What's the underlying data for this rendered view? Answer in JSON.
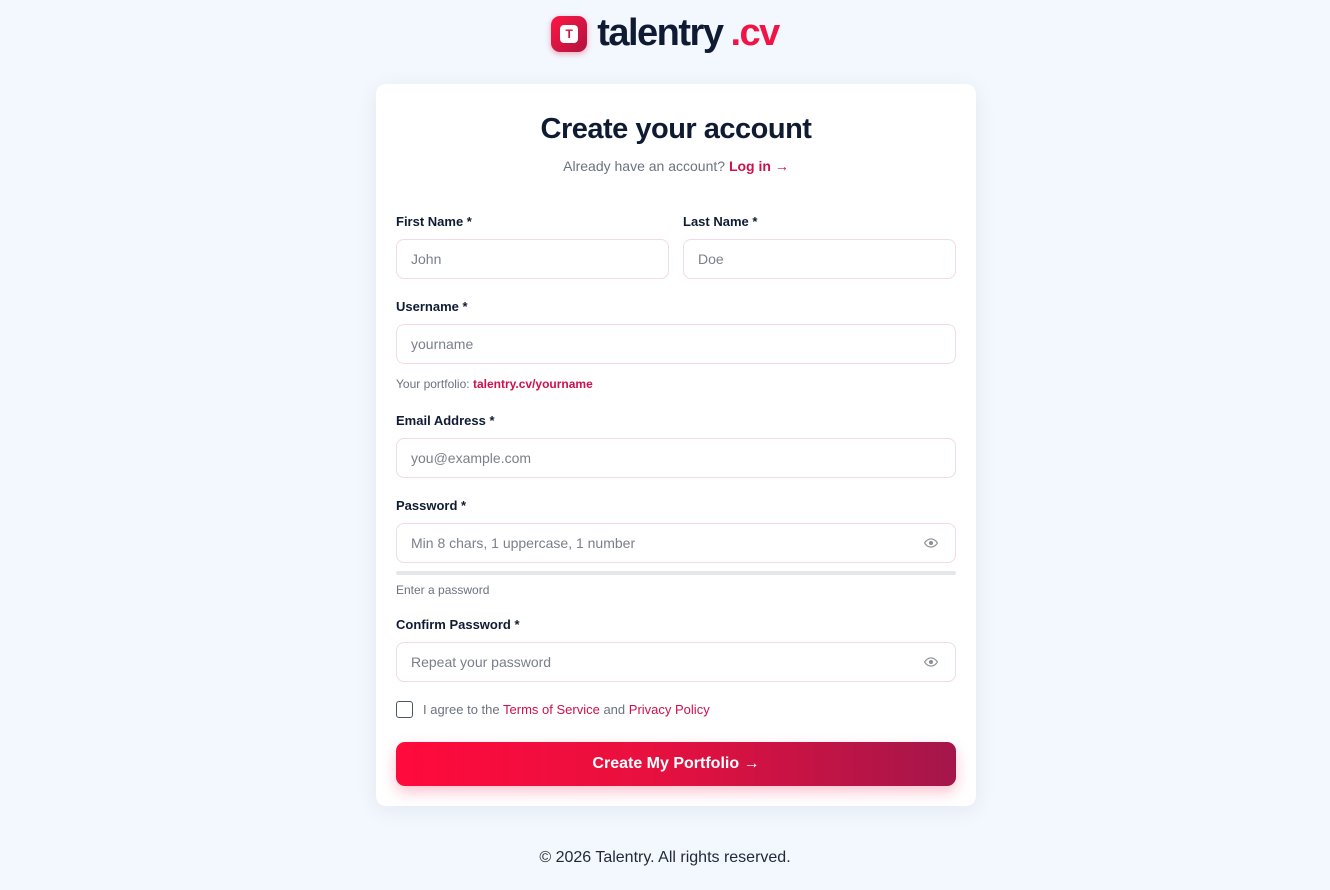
{
  "brand": {
    "mark": "T",
    "name": "talentry",
    "tld": ".cv"
  },
  "card": {
    "title": "Create your account",
    "subtitle_text": "Already have an account?",
    "login_link": "Log in →"
  },
  "form": {
    "first_name": {
      "label": "First Name *",
      "placeholder": "John"
    },
    "last_name": {
      "label": "Last Name *",
      "placeholder": "Doe"
    },
    "username": {
      "label": "Username *",
      "placeholder": "yourname",
      "hint_prefix": "Your portfolio:",
      "hint_link": "talentry.cv/yourname"
    },
    "email": {
      "label": "Email Address *",
      "placeholder": "you@example.com"
    },
    "password": {
      "label": "Password *",
      "placeholder": "Min 8 chars, 1 uppercase, 1 number",
      "strength_hint": "Enter a password",
      "strength_level": 0
    },
    "confirm_password": {
      "label": "Confirm Password *",
      "placeholder": "Repeat your password"
    },
    "agree": {
      "prefix": "I agree to the",
      "terms": "Terms of Service",
      "and": "and",
      "privacy": "Privacy Policy",
      "checked": false
    },
    "submit_label": "Create My Portfolio →"
  },
  "icons": {
    "password_toggle": "eye-icon",
    "confirm_toggle": "eye-icon"
  },
  "colors": {
    "accent": "#d0104a",
    "cta_start": "#ff0a3c",
    "cta_end": "#a4164a",
    "background": "#f3f7fe"
  },
  "footer": {
    "copyright": "© 2026 Talentry. All rights reserved."
  }
}
